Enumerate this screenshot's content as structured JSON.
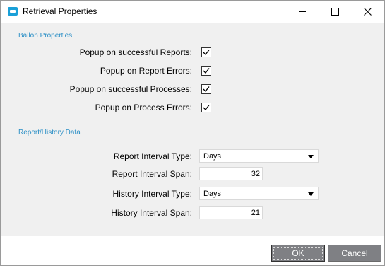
{
  "window": {
    "title": "Retrieval Properties",
    "icon": "app-icon"
  },
  "balloon": {
    "section_label": "Ballon Properties",
    "items": [
      {
        "label": "Popup on successful Reports:",
        "checked": true
      },
      {
        "label": "Popup on Report Errors:",
        "checked": true
      },
      {
        "label": "Popup on successful Processes:",
        "checked": true
      },
      {
        "label": "Popup on Process Errors:",
        "checked": true
      }
    ]
  },
  "report_history": {
    "section_label": "Report/History Data",
    "report_interval_type": {
      "label": "Report Interval Type:",
      "value": "Days"
    },
    "report_interval_span": {
      "label": "Report Interval Span:",
      "value": "32"
    },
    "history_interval_type": {
      "label": "History Interval Type:",
      "value": "Days"
    },
    "history_interval_span": {
      "label": "History Interval Span:",
      "value": "21"
    }
  },
  "buttons": {
    "ok": "OK",
    "cancel": "Cancel"
  },
  "colors": {
    "section_label": "#2b8fc6",
    "button_bg": "#7f8084",
    "app_icon": "#1aa0d8"
  }
}
